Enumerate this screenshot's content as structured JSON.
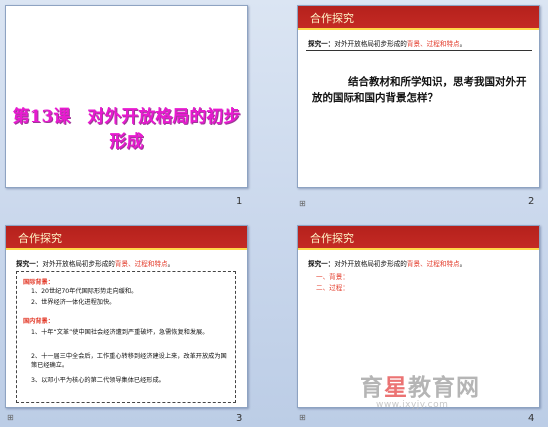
{
  "slides": [
    {
      "number": "1",
      "title": "第13课　对外开放格局的初步形成"
    },
    {
      "number": "2",
      "header": "合作探究",
      "probe_prefix": "探究一：",
      "probe_text": "对外开放格局初步形成的",
      "probe_red": "背景、过程和特点",
      "probe_end": "。",
      "question": "结合教材和所学知识，思考我国对外开放的国际和国内背景怎样？"
    },
    {
      "number": "3",
      "header": "合作探究",
      "probe_prefix": "探究一：",
      "probe_text": "对外开放格局初步形成的",
      "probe_red": "背景、过程和特点",
      "probe_end": "。",
      "intl_label": "国际背景：",
      "intl_items": [
        "1、20世纪70年代国际形势走向缓和。",
        "2、世界经济一体化进程加快。"
      ],
      "dom_label": "国内背景：",
      "dom_items": [
        "1、十年“文革”使中国社会经济遭到严重破坏，急需恢复和发展。",
        "2、十一届三中全会后，工作重心转移到经济建设上来，改革开放成为国策已经确立。",
        "3、以邓小平为核心的第二代领导集体已经形成。"
      ]
    },
    {
      "number": "4",
      "header": "合作探究",
      "probe_prefix": "探究一：",
      "probe_text": "对外开放格局初步形成的",
      "probe_red": "背景、过程和特点",
      "probe_end": "。",
      "items": [
        "一、背景：",
        "二、过程："
      ]
    }
  ],
  "watermark": {
    "part1": "育",
    "star": "星",
    "part2": "教育网",
    "sub": "www.ixyjy.com"
  },
  "colors": {
    "header": "#c42a24",
    "title": "#e81ad0",
    "accent_red": "#e33b2a"
  }
}
